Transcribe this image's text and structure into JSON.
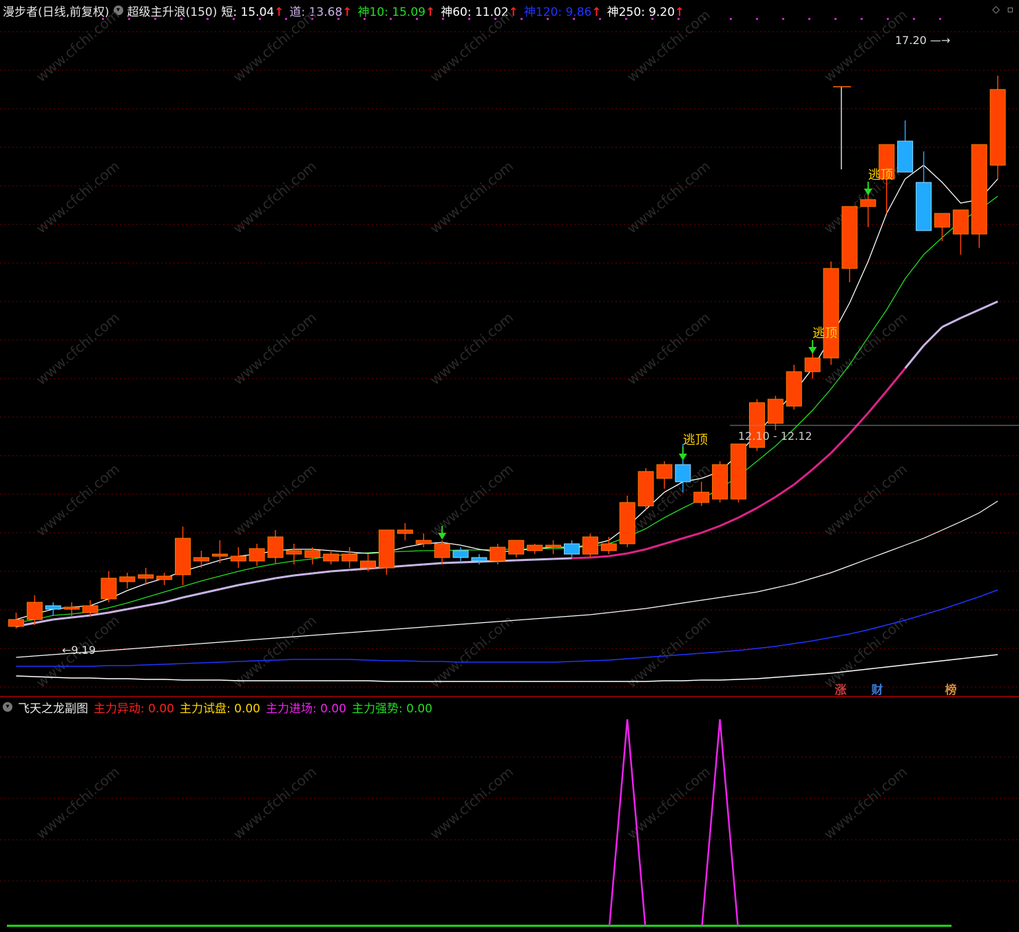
{
  "header": {
    "name": "漫步者",
    "period": "(日线,前复权)",
    "indicator": "超级主升浪(150)",
    "items": [
      {
        "label": "短:",
        "value": "15.04",
        "color": "#ffffff"
      },
      {
        "label": "道:",
        "value": "13.68",
        "color": "#c8b4e6"
      },
      {
        "label": "神10:",
        "value": "15.09",
        "color": "#22dd22"
      },
      {
        "label": "神60:",
        "value": "11.02",
        "color": "#ffffff"
      },
      {
        "label": "神120:",
        "value": "9.86",
        "color": "#2233ff"
      },
      {
        "label": "神250:",
        "value": "9.20",
        "color": "#ffffff"
      }
    ],
    "up_arrow": "↑"
  },
  "sub_header": {
    "name": "飞天之龙副图",
    "items": [
      {
        "label": "主力异动:",
        "value": "0.00",
        "color": "#ff2020"
      },
      {
        "label": "主力试盘:",
        "value": "0.00",
        "color": "#ffd400"
      },
      {
        "label": "主力进场:",
        "value": "0.00",
        "color": "#ee22ee"
      },
      {
        "label": "主力强势:",
        "value": "0.00",
        "color": "#22dd22"
      }
    ]
  },
  "annotations": {
    "high_label": "17.20",
    "low_label": "9.19",
    "range_label": "12.10 - 12.12",
    "signal_text": "逃顶",
    "watermark": "www.cfchi.com",
    "badges": [
      {
        "text": "涨",
        "color": "#c83c3c"
      },
      {
        "text": "财",
        "color": "#3c7ad2"
      },
      {
        "text": "榜",
        "color": "#d28c3c"
      }
    ]
  },
  "colors": {
    "up": "#ff4400",
    "down": "#22aaff",
    "grid": "#7a0000",
    "ma_short": "#ffffff",
    "ma_dao": "#c8b4e6",
    "ma10": "#22dd22",
    "ma_pink": "#dd2288",
    "ma60": "#ffffff",
    "ma120": "#2233ff",
    "ma250": "#ffffff",
    "signal": "#ffd400",
    "sub_line": "#ee22ee",
    "sub_base": "#22dd22"
  },
  "chart_data": {
    "type": "candlestick",
    "ylim": [
      8.3,
      17.9
    ],
    "candles": [
      {
        "o": 9.2,
        "h": 9.4,
        "l": 9.17,
        "c": 9.3
      },
      {
        "o": 9.3,
        "h": 9.65,
        "l": 9.22,
        "c": 9.55
      },
      {
        "o": 9.5,
        "h": 9.55,
        "l": 9.35,
        "c": 9.45
      },
      {
        "o": 9.45,
        "h": 9.55,
        "l": 9.35,
        "c": 9.48
      },
      {
        "o": 9.4,
        "h": 9.58,
        "l": 9.35,
        "c": 9.5
      },
      {
        "o": 9.6,
        "h": 10.0,
        "l": 9.55,
        "c": 9.9
      },
      {
        "o": 9.85,
        "h": 9.98,
        "l": 9.75,
        "c": 9.92
      },
      {
        "o": 9.9,
        "h": 10.05,
        "l": 9.8,
        "c": 9.95
      },
      {
        "o": 9.88,
        "h": 9.98,
        "l": 9.8,
        "c": 9.93
      },
      {
        "o": 9.95,
        "h": 10.65,
        "l": 9.8,
        "c": 10.48
      },
      {
        "o": 10.15,
        "h": 10.3,
        "l": 10.05,
        "c": 10.2
      },
      {
        "o": 10.22,
        "h": 10.45,
        "l": 10.12,
        "c": 10.25
      },
      {
        "o": 10.15,
        "h": 10.35,
        "l": 10.05,
        "c": 10.22
      },
      {
        "o": 10.15,
        "h": 10.4,
        "l": 10.08,
        "c": 10.33
      },
      {
        "o": 10.2,
        "h": 10.6,
        "l": 10.1,
        "c": 10.5
      },
      {
        "o": 10.25,
        "h": 10.4,
        "l": 10.1,
        "c": 10.3
      },
      {
        "o": 10.2,
        "h": 10.35,
        "l": 10.1,
        "c": 10.3
      },
      {
        "o": 10.15,
        "h": 10.3,
        "l": 10.1,
        "c": 10.25
      },
      {
        "o": 10.15,
        "h": 10.35,
        "l": 10.05,
        "c": 10.25
      },
      {
        "o": 10.05,
        "h": 10.25,
        "l": 10.0,
        "c": 10.15
      },
      {
        "o": 10.05,
        "h": 10.6,
        "l": 9.95,
        "c": 10.6
      },
      {
        "o": 10.55,
        "h": 10.7,
        "l": 10.45,
        "c": 10.6
      },
      {
        "o": 10.4,
        "h": 10.55,
        "l": 10.35,
        "c": 10.45
      },
      {
        "o": 10.2,
        "h": 10.45,
        "l": 10.1,
        "c": 10.4
      },
      {
        "o": 10.3,
        "h": 10.35,
        "l": 10.15,
        "c": 10.2
      },
      {
        "o": 10.2,
        "h": 10.25,
        "l": 10.1,
        "c": 10.15
      },
      {
        "o": 10.15,
        "h": 10.4,
        "l": 10.1,
        "c": 10.35
      },
      {
        "o": 10.25,
        "h": 10.45,
        "l": 10.2,
        "c": 10.45
      },
      {
        "o": 10.3,
        "h": 10.4,
        "l": 10.25,
        "c": 10.38
      },
      {
        "o": 10.35,
        "h": 10.45,
        "l": 10.25,
        "c": 10.38
      },
      {
        "o": 10.4,
        "h": 10.45,
        "l": 10.2,
        "c": 10.25
      },
      {
        "o": 10.25,
        "h": 10.55,
        "l": 10.2,
        "c": 10.5
      },
      {
        "o": 10.3,
        "h": 10.5,
        "l": 10.25,
        "c": 10.4
      },
      {
        "o": 10.4,
        "h": 11.1,
        "l": 10.35,
        "c": 11.0
      },
      {
        "o": 10.95,
        "h": 11.5,
        "l": 10.9,
        "c": 11.45
      },
      {
        "o": 11.35,
        "h": 11.6,
        "l": 11.2,
        "c": 11.55
      },
      {
        "o": 11.55,
        "h": 11.85,
        "l": 11.15,
        "c": 11.3
      },
      {
        "o": 11.0,
        "h": 11.3,
        "l": 10.95,
        "c": 11.15
      },
      {
        "o": 11.05,
        "h": 11.6,
        "l": 11.0,
        "c": 11.55
      },
      {
        "o": 11.05,
        "h": 11.85,
        "l": 11.0,
        "c": 11.85
      },
      {
        "o": 11.8,
        "h": 12.5,
        "l": 11.75,
        "c": 12.45
      },
      {
        "o": 12.15,
        "h": 12.55,
        "l": 12.05,
        "c": 12.5
      },
      {
        "o": 12.4,
        "h": 13.0,
        "l": 12.35,
        "c": 12.9
      },
      {
        "o": 12.9,
        "h": 13.3,
        "l": 12.8,
        "c": 13.1
      },
      {
        "o": 13.1,
        "h": 14.5,
        "l": 13.0,
        "c": 14.4
      },
      {
        "o": 14.4,
        "h": 15.1,
        "l": 14.2,
        "c": 15.3
      },
      {
        "o": 15.3,
        "h": 15.6,
        "l": 15.0,
        "c": 15.4
      },
      {
        "o": 15.7,
        "h": 16.1,
        "l": 15.2,
        "c": 16.2
      },
      {
        "o": 16.25,
        "h": 16.55,
        "l": 15.85,
        "c": 15.8
      },
      {
        "o": 15.65,
        "h": 16.1,
        "l": 15.1,
        "c": 14.95
      },
      {
        "o": 15.0,
        "h": 15.1,
        "l": 14.8,
        "c": 15.2
      },
      {
        "o": 14.9,
        "h": 15.05,
        "l": 14.6,
        "c": 15.25
      },
      {
        "o": 14.9,
        "h": 15.95,
        "l": 14.7,
        "c": 16.2
      },
      {
        "o": 15.9,
        "h": 17.2,
        "l": 15.7,
        "c": 17.0
      }
    ],
    "ma_dao": [
      9.2,
      9.25,
      9.3,
      9.33,
      9.36,
      9.4,
      9.45,
      9.5,
      9.55,
      9.62,
      9.68,
      9.74,
      9.8,
      9.85,
      9.9,
      9.94,
      9.97,
      10.0,
      10.02,
      10.04,
      10.06,
      10.08,
      10.1,
      10.12,
      10.13,
      10.14,
      10.15,
      10.16,
      10.17,
      10.18,
      10.19,
      10.2,
      10.22,
      10.26,
      10.32,
      10.4,
      10.48,
      10.56,
      10.66,
      10.78,
      10.92,
      11.08,
      11.26,
      11.48,
      11.72,
      12.0,
      12.3,
      12.62,
      12.95,
      13.28,
      13.55,
      13.68,
      13.8,
      13.92
    ],
    "ma10": [
      9.25,
      9.3,
      9.36,
      9.38,
      9.41,
      9.47,
      9.54,
      9.62,
      9.7,
      9.78,
      9.86,
      9.93,
      10.0,
      10.06,
      10.11,
      10.15,
      10.18,
      10.22,
      10.25,
      10.27,
      10.28,
      10.29,
      10.3,
      10.3,
      10.31,
      10.31,
      10.32,
      10.32,
      10.33,
      10.33,
      10.34,
      10.36,
      10.4,
      10.5,
      10.62,
      10.78,
      10.92,
      11.05,
      11.2,
      11.38,
      11.6,
      11.82,
      12.07,
      12.34,
      12.65,
      13.0,
      13.4,
      13.8,
      14.25,
      14.6,
      14.85,
      15.09,
      15.25,
      15.45
    ],
    "ma_short": [
      9.3,
      9.38,
      9.45,
      9.48,
      9.5,
      9.6,
      9.72,
      9.82,
      9.9,
      10.0,
      10.08,
      10.16,
      10.22,
      10.25,
      10.3,
      10.32,
      10.32,
      10.3,
      10.28,
      10.26,
      10.28,
      10.35,
      10.4,
      10.42,
      10.38,
      10.32,
      10.28,
      10.3,
      10.33,
      10.35,
      10.35,
      10.38,
      10.45,
      10.65,
      10.9,
      11.15,
      11.3,
      11.35,
      11.45,
      11.7,
      12.0,
      12.3,
      12.6,
      12.95,
      13.4,
      13.9,
      14.5,
      15.2,
      15.7,
      15.9,
      15.65,
      15.35,
      15.4,
      15.7
    ],
    "ma60": [
      8.75,
      8.77,
      8.79,
      8.81,
      8.83,
      8.85,
      8.87,
      8.89,
      8.91,
      8.93,
      8.95,
      8.97,
      8.99,
      9.01,
      9.03,
      9.05,
      9.07,
      9.09,
      9.11,
      9.13,
      9.15,
      9.17,
      9.19,
      9.21,
      9.23,
      9.25,
      9.27,
      9.29,
      9.31,
      9.33,
      9.35,
      9.37,
      9.4,
      9.43,
      9.46,
      9.5,
      9.54,
      9.58,
      9.62,
      9.66,
      9.7,
      9.76,
      9.82,
      9.9,
      9.98,
      10.08,
      10.18,
      10.28,
      10.38,
      10.48,
      10.6,
      10.72,
      10.85,
      11.02
    ],
    "ma120": [
      8.62,
      8.62,
      8.62,
      8.62,
      8.62,
      8.63,
      8.63,
      8.64,
      8.65,
      8.66,
      8.67,
      8.68,
      8.69,
      8.7,
      8.71,
      8.72,
      8.72,
      8.72,
      8.72,
      8.71,
      8.7,
      8.7,
      8.69,
      8.69,
      8.68,
      8.68,
      8.68,
      8.68,
      8.68,
      8.68,
      8.69,
      8.7,
      8.71,
      8.73,
      8.75,
      8.77,
      8.79,
      8.81,
      8.83,
      8.85,
      8.88,
      8.91,
      8.95,
      8.99,
      9.04,
      9.09,
      9.15,
      9.22,
      9.29,
      9.37,
      9.45,
      9.54,
      9.63,
      9.73
    ],
    "ma250": [
      8.48,
      8.47,
      8.46,
      8.45,
      8.45,
      8.44,
      8.44,
      8.43,
      8.43,
      8.42,
      8.42,
      8.42,
      8.41,
      8.41,
      8.41,
      8.41,
      8.41,
      8.41,
      8.41,
      8.41,
      8.4,
      8.4,
      8.4,
      8.4,
      8.4,
      8.4,
      8.4,
      8.4,
      8.4,
      8.4,
      8.4,
      8.4,
      8.4,
      8.4,
      8.4,
      8.41,
      8.41,
      8.42,
      8.42,
      8.43,
      8.44,
      8.46,
      8.48,
      8.5,
      8.52,
      8.55,
      8.58,
      8.61,
      8.64,
      8.67,
      8.7,
      8.73,
      8.76,
      8.79
    ],
    "signals_down": [
      23,
      36,
      43,
      46
    ],
    "signal_label_idx": [
      36,
      43,
      46
    ],
    "sub_peaks": [
      33,
      38
    ],
    "sub_ylim": [
      0,
      1
    ]
  }
}
